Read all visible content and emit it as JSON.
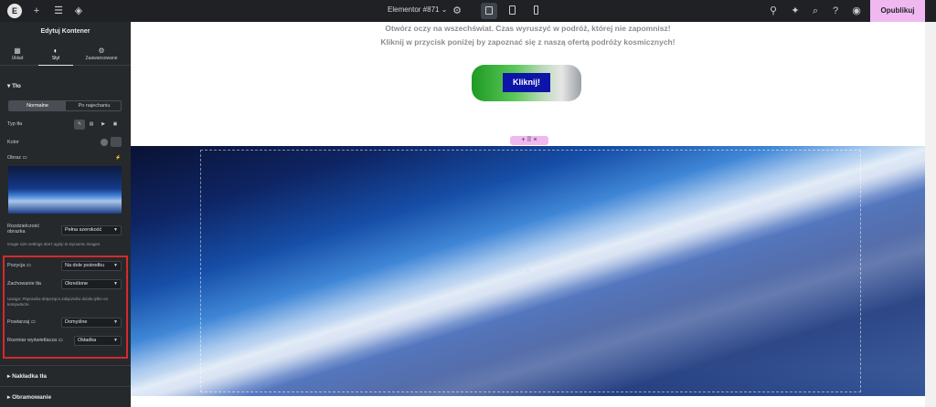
{
  "topbar": {
    "logo": "E",
    "page_title": "Elementor #871",
    "publish_label": "Opublikuj"
  },
  "panel": {
    "title": "Edytuj Kontener",
    "tabs": [
      {
        "label": "Układ",
        "icon": "layout-icon"
      },
      {
        "label": "Styl",
        "icon": "style-icon"
      },
      {
        "label": "Zaawansowane",
        "icon": "gear-icon"
      }
    ],
    "section_background": "Tło",
    "toggle_normal": "Normalne",
    "toggle_hover": "Po najechaniu",
    "bg_type_label": "Typ tła",
    "color_label": "Kolor",
    "image_label": "Obraz",
    "image_resolution_label": "Rozdzielczość obrazka",
    "image_resolution_value": "Pełna szerokość",
    "image_note": "Image size settings don't apply to Dynamic Images.",
    "position_label": "Pozycja",
    "position_value": "Na dole pośrodku",
    "attachment_label": "Zachowanie tła",
    "attachment_value": "Określone",
    "attachment_note": "Uwaga: Poprawka dotycząca załącznika działa tylko na komputerze.",
    "repeat_label": "Powtarzaj",
    "repeat_value": "Domyślne",
    "display_size_label": "Rozmiar wyświetlacza",
    "display_size_value": "Okładka",
    "section_overlay": "Nakładka tła",
    "section_border": "Obramowanie"
  },
  "canvas": {
    "line1": "Otwórz oczy na wszechświat. Czas wyruszyć w podróż, której nie zapomnisz!",
    "line2": "Kliknij w przycisk poniżej by zapoznać się z naszą ofertą podróży kosmicznych!",
    "button_label": "Kliknij!",
    "handle_glyphs": "+  ⠿  ×"
  },
  "colors": {
    "panel_bg": "#26292c",
    "topbar_bg": "#1f2124",
    "publish_bg": "#f0b8f0",
    "highlight_box": "#d22b2b",
    "button_bg": "#0d14a8"
  }
}
